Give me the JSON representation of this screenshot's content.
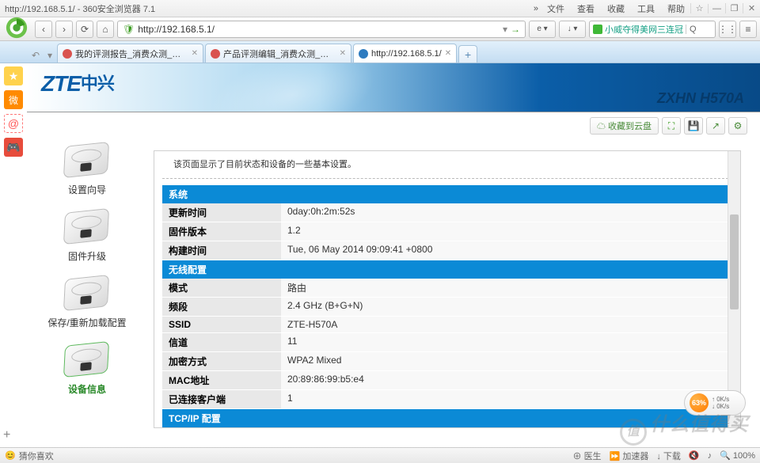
{
  "window": {
    "title": "http://192.168.5.1/ - 360安全浏览器 7.1",
    "show_more": "»",
    "menus": [
      "文件",
      "查看",
      "收藏",
      "工具",
      "帮助"
    ],
    "win_bookmark": "☆"
  },
  "toolbar": {
    "back": "‹",
    "forward": "›",
    "reload": "⟳",
    "home": "⌂",
    "shield": "🛡",
    "url": "http://192.168.5.1/",
    "url_dropdown": "▾",
    "go": "→",
    "ext_e": "e ▾",
    "ext_dl": "↓ ▾",
    "search_icon": "🔍",
    "search_text": "小威夺得美网三连冠",
    "search_btn": "Q",
    "menu_grid": "⋮⋮"
  },
  "tabs": {
    "items": [
      {
        "label": "我的评测报告_消费众测_什么值得买",
        "fav": "#d9534f"
      },
      {
        "label": "产品评测编辑_消费众测_什么值得买",
        "fav": "#d9534f"
      },
      {
        "label": "http://192.168.5.1/",
        "fav": "#2e7bbf"
      }
    ],
    "new": "+",
    "undo": "↶"
  },
  "sidebar_launcher": {
    "star": "★",
    "weibo": "微",
    "at": "@",
    "game": "🎮"
  },
  "zte": {
    "logo": "ZTE",
    "logo_cn": "中兴",
    "model": "ZXHN H570A"
  },
  "actions": {
    "cloud": "☁ 收藏到云盘",
    "fullscreen": "⛶",
    "save": "💾",
    "share": "↗",
    "settings": "⚙"
  },
  "nav": {
    "items": [
      {
        "label": "设置向导"
      },
      {
        "label": "固件升级"
      },
      {
        "label": "保存/重新加载配置"
      },
      {
        "label": "设备信息"
      }
    ]
  },
  "panel": {
    "desc": "该页面显示了目前状态和设备的一些基本设置。",
    "sections": [
      {
        "title": "系统",
        "rows": [
          {
            "k": "更新时间",
            "v": "0day:0h:2m:52s"
          },
          {
            "k": "固件版本",
            "v": "1.2"
          },
          {
            "k": "构建时间",
            "v": "Tue, 06 May 2014 09:09:41 +0800"
          }
        ]
      },
      {
        "title": "无线配置",
        "rows": [
          {
            "k": "模式",
            "v": "路由"
          },
          {
            "k": "频段",
            "v": "2.4 GHz (B+G+N)"
          },
          {
            "k": "SSID",
            "v": "ZTE-H570A"
          },
          {
            "k": "信道",
            "v": "11"
          },
          {
            "k": "加密方式",
            "v": "WPA2 Mixed"
          },
          {
            "k": "MAC地址",
            "v": "20:89:86:99:b5:e4"
          },
          {
            "k": "已连接客户端",
            "v": "1"
          }
        ]
      },
      {
        "title": "TCP/IP 配置",
        "rows": []
      }
    ]
  },
  "speed": {
    "pct": "63%",
    "up": "0K/s",
    "down": "0K/s"
  },
  "status": {
    "left_icon": "😊",
    "left_text": "猜你喜欢",
    "items": [
      "医生",
      "加速器",
      "下载",
      "♪",
      "100%"
    ],
    "doctor": "⊕",
    "accel": "⏩",
    "dl": "↓",
    "sound": "🔇",
    "zoom_icon": "🔍"
  },
  "watermark": "什么值得买"
}
